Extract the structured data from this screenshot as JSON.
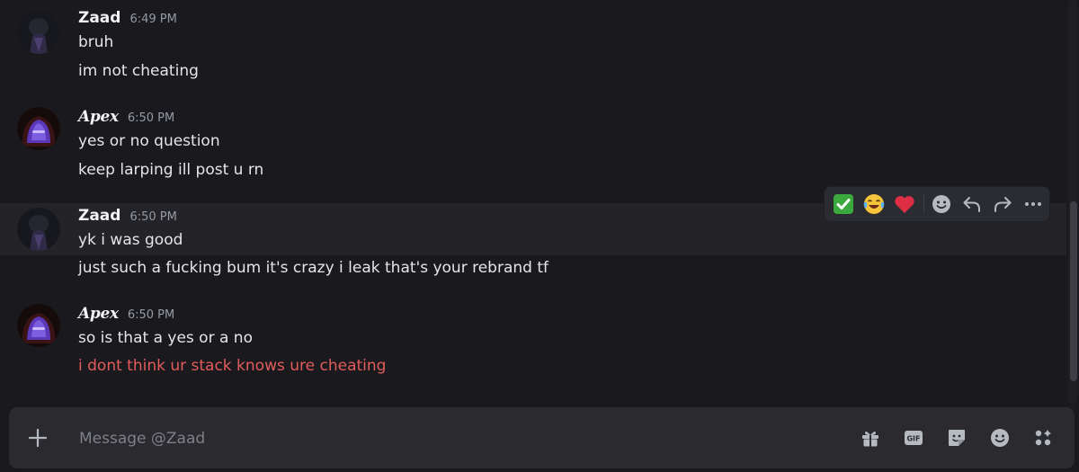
{
  "messages": [
    {
      "author": "Zaad",
      "time": "6:49 PM",
      "lines": [
        "bruh",
        "im not cheating"
      ]
    },
    {
      "author": "Apex",
      "time": "6:50 PM",
      "lines": [
        "yes or no question",
        "keep larping ill post u rn"
      ]
    },
    {
      "author": "Zaad",
      "time": "6:50 PM",
      "lines": [
        "yk i was good",
        "just such a fucking bum it's crazy i leak that's your rebrand tf"
      ]
    },
    {
      "author": "Apex",
      "time": "6:50 PM",
      "lines": [
        "so is that a yes or a no",
        "i dont think ur stack knows ure cheating"
      ]
    }
  ],
  "toolbar": {
    "reactions": [
      "check-mark-emoji",
      "laughing-emoji",
      "heart-emoji"
    ],
    "actions": [
      "add-reaction",
      "reply",
      "forward",
      "more"
    ]
  },
  "composer": {
    "placeholder": "Message @Zaad"
  },
  "composer_icons": [
    "gift-icon",
    "gif-icon",
    "sticker-icon",
    "emoji-icon",
    "apps-icon"
  ],
  "colors": {
    "background": "#1a1a1e",
    "hover_row": "#242428",
    "composer": "#2a2a2f",
    "highlight_text": "#e25c5c"
  }
}
